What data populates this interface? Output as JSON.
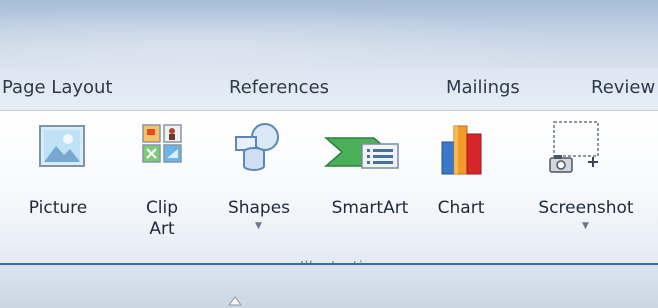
{
  "tabs": [
    {
      "label": "Page Layout"
    },
    {
      "label": "References"
    },
    {
      "label": "Mailings"
    },
    {
      "label": "Review"
    }
  ],
  "buttons": [
    {
      "label": "Picture",
      "icon": "picture-icon"
    },
    {
      "label": "Clip",
      "label2": "Art",
      "icon": "clip-art-icon"
    },
    {
      "label": "Shapes",
      "icon": "shapes-icon",
      "dropdown": true
    },
    {
      "label": "SmartArt",
      "icon": "smartart-icon"
    },
    {
      "label": "Chart",
      "icon": "chart-icon"
    },
    {
      "label": "Screenshot",
      "icon": "screenshot-icon",
      "dropdown": true
    }
  ],
  "group": {
    "label": "Illustrations"
  },
  "colors": {
    "accent_line": "#3a6ea5"
  }
}
